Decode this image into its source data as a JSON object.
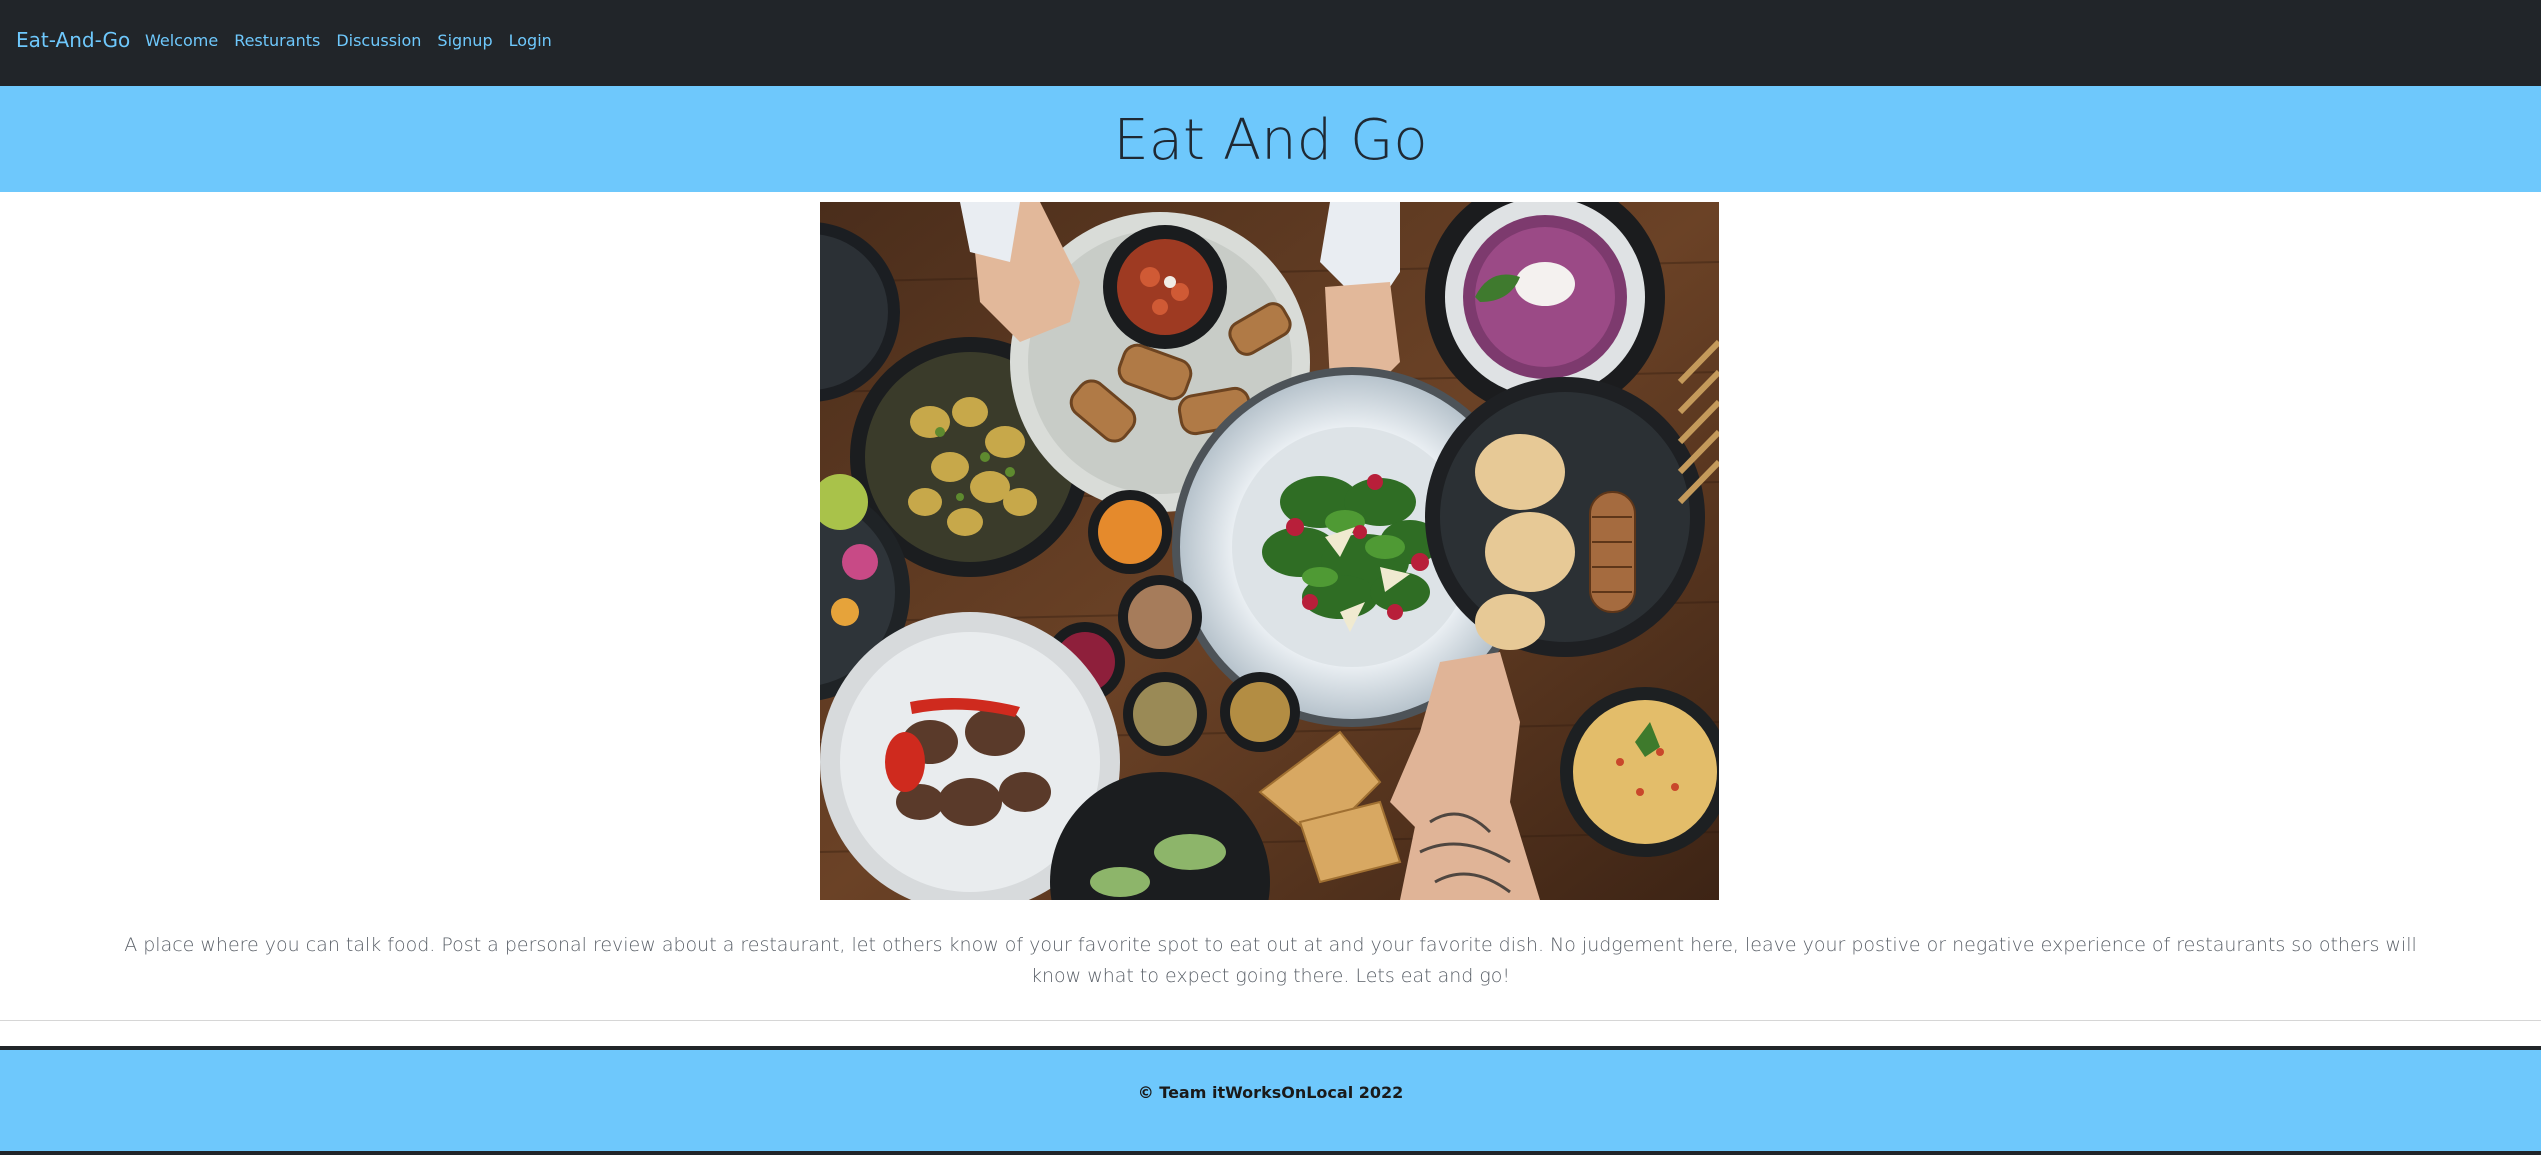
{
  "navbar": {
    "brand": "Eat-And-Go",
    "links": [
      "Welcome",
      "Resturants",
      "Discussion",
      "Signup",
      "Login"
    ]
  },
  "hero": {
    "title": "Eat And Go"
  },
  "content": {
    "description": "A place where you can talk food. Post a personal review about a restaurant, let others know of your favorite spot to eat out at and your favorite dish. No judgement here, leave your postive or negative experience of restaurants so others will know what to expect going there. Lets eat and go!"
  },
  "footer": {
    "text": "© Team itWorksOnLocal 2022"
  },
  "colors": {
    "navbar_bg": "#212529",
    "accent": "#6ec8fc",
    "text_dark": "#1f2933",
    "text_muted": "#5b6169"
  }
}
